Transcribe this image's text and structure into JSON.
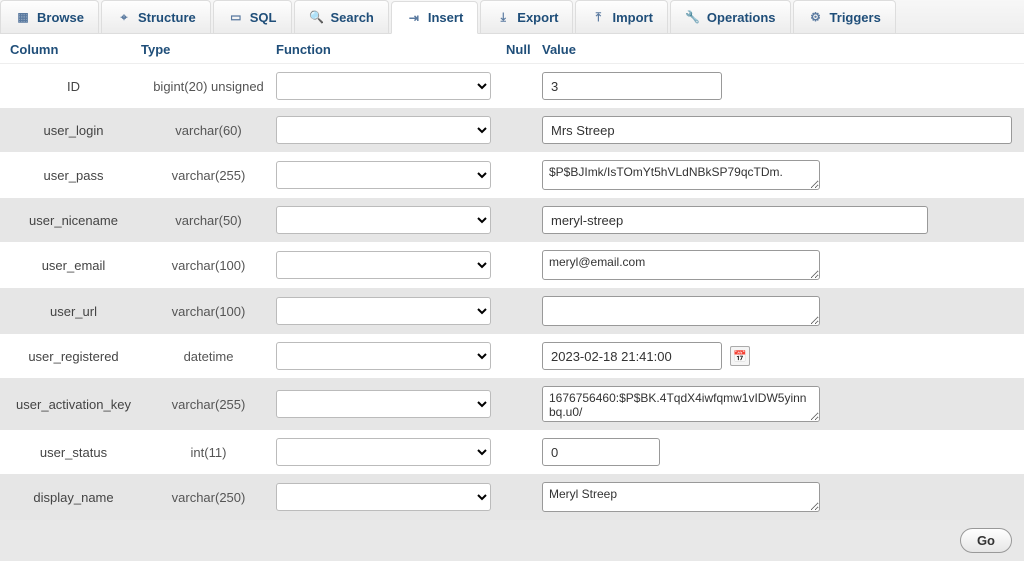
{
  "tabs": {
    "browse": "Browse",
    "structure": "Structure",
    "sql": "SQL",
    "search": "Search",
    "insert": "Insert",
    "export": "Export",
    "import": "Import",
    "operations": "Operations",
    "triggers": "Triggers"
  },
  "headers": {
    "column": "Column",
    "type": "Type",
    "function": "Function",
    "null": "Null",
    "value": "Value"
  },
  "rows": {
    "id": {
      "col": "ID",
      "type": "bigint(20) unsigned",
      "value": "3"
    },
    "login": {
      "col": "user_login",
      "type": "varchar(60)",
      "value": "Mrs Streep"
    },
    "pass": {
      "col": "user_pass",
      "type": "varchar(255)",
      "value": "$P$BJImk/IsTOmYt5hVLdNBkSP79qcTDm."
    },
    "nice": {
      "col": "user_nicename",
      "type": "varchar(50)",
      "value": "meryl-streep"
    },
    "email": {
      "col": "user_email",
      "type": "varchar(100)",
      "value": "meryl@email.com"
    },
    "url": {
      "col": "user_url",
      "type": "varchar(100)",
      "value": ""
    },
    "reg": {
      "col": "user_registered",
      "type": "datetime",
      "value": "2023-02-18 21:41:00"
    },
    "akey": {
      "col": "user_activation_key",
      "type": "varchar(255)",
      "value": "1676756460:$P$BK.4TqdX4iwfqmw1vIDW5yinnbq.u0/"
    },
    "status": {
      "col": "user_status",
      "type": "int(11)",
      "value": "0"
    },
    "dname": {
      "col": "display_name",
      "type": "varchar(250)",
      "value": "Meryl Streep"
    }
  },
  "footer": {
    "go": "Go"
  }
}
